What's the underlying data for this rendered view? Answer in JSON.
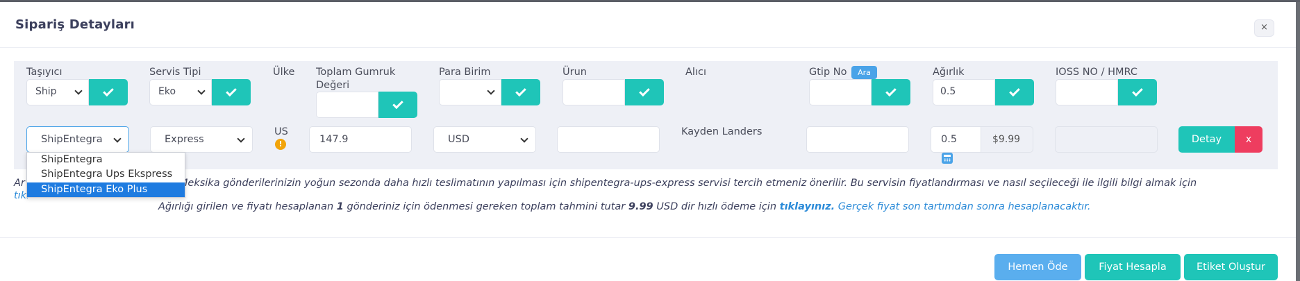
{
  "modal": {
    "title": "Sipariş Detayları",
    "close_label": "×"
  },
  "headers": {
    "tasiyici": "Taşıyıcı",
    "servis_tipi": "Servis Tipi",
    "ulke": "Ülke",
    "gumruk_line1": "Toplam Gumruk",
    "gumruk_line2": "Değeri",
    "para_birim": "Para Birim",
    "urun": "Ürun",
    "alici": "Alıcı",
    "gtip_no": "Gtip No",
    "gtip_badge": "Ara",
    "agirlik": "Ağırlık",
    "ioss": "IOSS NO / HMRC"
  },
  "filters": {
    "tasiyici_value": "Ship",
    "servis_value": "Eko",
    "agirlik_value": "0.5"
  },
  "row": {
    "carrier": "ShipEntegra",
    "service": "Express",
    "country": "US",
    "info_icon_glyph": "!",
    "customs_value": "147.9",
    "currency": "USD",
    "recipient": "Kayden Landers",
    "weight": "0.5",
    "price": "$9.99",
    "detail_label": "Detay",
    "remove_label": "x"
  },
  "dropdown": {
    "options": [
      "ShipEntegra",
      "ShipEntegra Ups Ekspress",
      "ShipEntegra Eko Plus"
    ],
    "selected_index": 2
  },
  "notice": {
    "prefix": "Ar",
    "text": "Meksika gönderilerinizin yoğun sezonda daha hızlı teslimatının yapılması için shipentegra-ups-express servisi tercih etmeniz önerilir. Bu servisin fiyatlandırması ve nasıl seçileceği ile ilgili bilgi almak için",
    "link_partial": "tıkl"
  },
  "summary": {
    "part1": "Ağırlığı girilen ve fiyatı hesaplanan",
    "count": "1",
    "part2": "gönderiniz için ödenmesi gereken toplam tahmini tutar",
    "amount": "9.99",
    "currency": "USD",
    "part3": "dir hızlı ödeme için",
    "pay_link": "tıklayınız.",
    "note": "Gerçek fiyat son tartımdan sonra hesaplanacaktır."
  },
  "footer": {
    "pay_now": "Hemen Öde",
    "calc_price": "Fiyat Hesapla",
    "create_label": "Etiket Oluştur"
  },
  "colors": {
    "accent_teal": "#1fc5b8",
    "accent_blue": "#4aa3e8",
    "danger": "#ee3d5f",
    "selected_option": "#1e7be0"
  }
}
